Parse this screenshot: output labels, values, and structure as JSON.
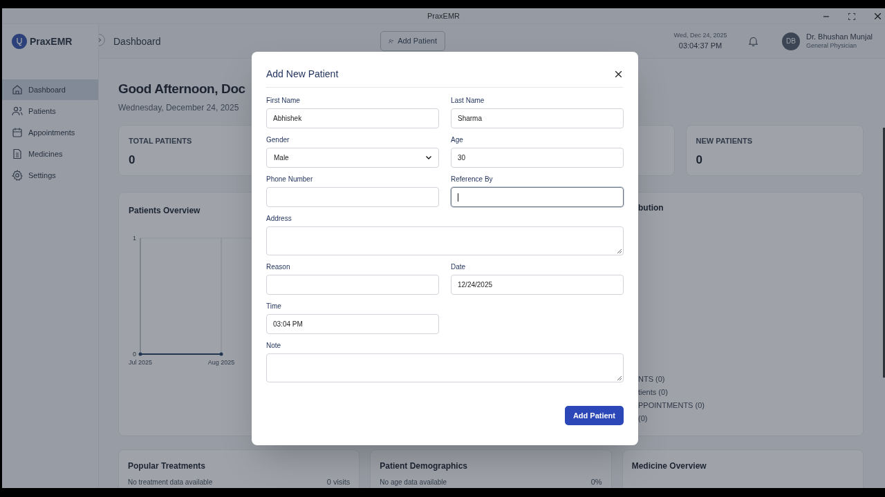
{
  "window": {
    "title": "PraxEMR"
  },
  "sidebar": {
    "brand": "PraxEMR",
    "items": [
      {
        "label": "Dashboard",
        "selected": true
      },
      {
        "label": "Patients",
        "selected": false
      },
      {
        "label": "Appointments",
        "selected": false
      },
      {
        "label": "Medicines",
        "selected": false
      },
      {
        "label": "Settings",
        "selected": false
      }
    ]
  },
  "header": {
    "title": "Dashboard",
    "action": "Add Patient",
    "date": "Wed, Dec 24, 2025",
    "time": "03:04:37 PM",
    "user": {
      "initials": "DB",
      "name": "Dr. Bhushan Munjal",
      "role": "General Physician"
    }
  },
  "dashboard": {
    "greeting": "Good Afternoon, Doc",
    "date": "Wednesday, December 24, 2025",
    "stats": [
      {
        "label": "TOTAL PATIENTS",
        "value": "0"
      },
      {
        "label": "NEW PATIENTS",
        "value": "0"
      }
    ],
    "overview": {
      "title": "Patients Overview",
      "chart_data": {
        "type": "line",
        "categories": [
          "Jul 2025",
          "Aug 2025"
        ],
        "series": [
          {
            "color": "#1e3a5f",
            "values": [
              0,
              0
            ]
          }
        ],
        "ylim": [
          0,
          1
        ],
        "yticks": [
          0,
          1
        ]
      }
    },
    "distribution": {
      "title": "bution",
      "legend": [
        "NTS (0)",
        "tients (0)",
        "PPOINTMENTS (0)",
        "(0)"
      ]
    },
    "bottom_cards": [
      {
        "title": "Popular Treatments",
        "label": "No treatment data available",
        "value": "0 visits"
      },
      {
        "title": "Patient Demographics",
        "label": "No age data available",
        "value": "0%"
      },
      {
        "title": "Medicine Overview"
      }
    ]
  },
  "modal": {
    "title": "Add New Patient",
    "fields": [
      {
        "label": "First Name",
        "kind": "text",
        "value": "Abhishek",
        "focused": false
      },
      {
        "label": "Last Name",
        "kind": "text",
        "value": "Sharma",
        "focused": false
      },
      {
        "label": "Gender",
        "kind": "select",
        "value": "Male",
        "focused": false
      },
      {
        "label": "Age",
        "kind": "text",
        "value": "30",
        "focused": false
      },
      {
        "label": "Phone Number",
        "kind": "text",
        "focused": false
      },
      {
        "label": "Reference By",
        "kind": "text",
        "focused": true
      },
      {
        "label": "Address",
        "kind": "textarea",
        "focused": false
      },
      {
        "label": "Reason",
        "kind": "text",
        "focused": false
      },
      {
        "label": "Date",
        "kind": "text",
        "value": "12/24/2025",
        "focused": false
      },
      {
        "label": "Time",
        "kind": "text",
        "value": "03:04 PM",
        "focused": false
      },
      {
        "label": "Note",
        "kind": "textarea",
        "focused": false
      }
    ],
    "submit": "Add Patient"
  }
}
